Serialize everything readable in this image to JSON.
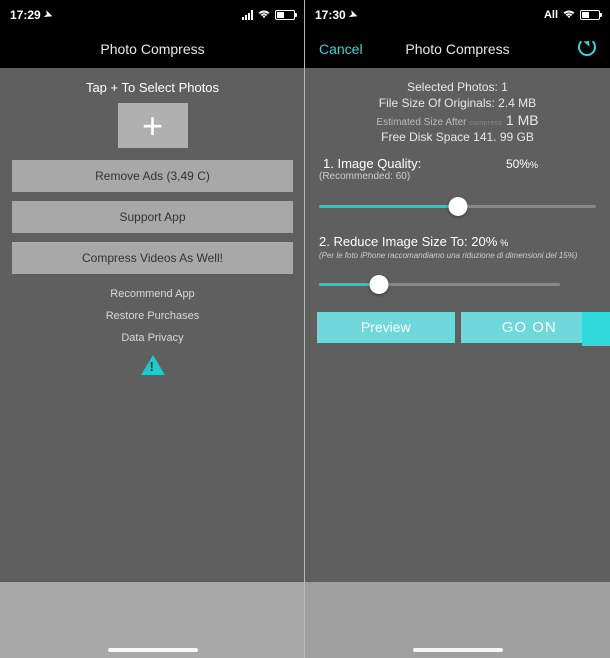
{
  "screen1": {
    "status": {
      "time": "17:29",
      "carrier_text": ""
    },
    "nav": {
      "title": "Photo Compress"
    },
    "tap_prompt": "Tap + To Select Photos",
    "buttons": {
      "remove_ads": "Remove Ads (3,49 C)",
      "support_app": "Support App",
      "compress_videos": "Compress Videos As Well!"
    },
    "links": {
      "recommend": "Recommend App",
      "restore": "Restore Purchases",
      "privacy": "Data Privacy"
    }
  },
  "screen2": {
    "status": {
      "time": "17:30",
      "carrier_text": "All"
    },
    "nav": {
      "cancel": "Cancel",
      "title": "Photo Compress"
    },
    "info": {
      "selected": "Selected Photos: 1",
      "file_size": "File Size Of Originals: 2.4 MB",
      "est_prefix": "Estimated Size After ",
      "est_mid": "compress",
      "est_value": " 1 MB",
      "free_disk": "Free Disk Space 141. 99 GB"
    },
    "quality": {
      "label": "1. Image Quality:",
      "value": "50%",
      "recommended": "(Recommended: 60)",
      "slider_pct": 50
    },
    "reduce": {
      "label": "2. Reduce Image Size To: 20%",
      "note": "(Per le foto iPhone raccomandiamo una riduzione di dimensioni del 15%)",
      "slider_pct": 25
    },
    "actions": {
      "preview": "Preview",
      "go": "GO ON"
    }
  }
}
